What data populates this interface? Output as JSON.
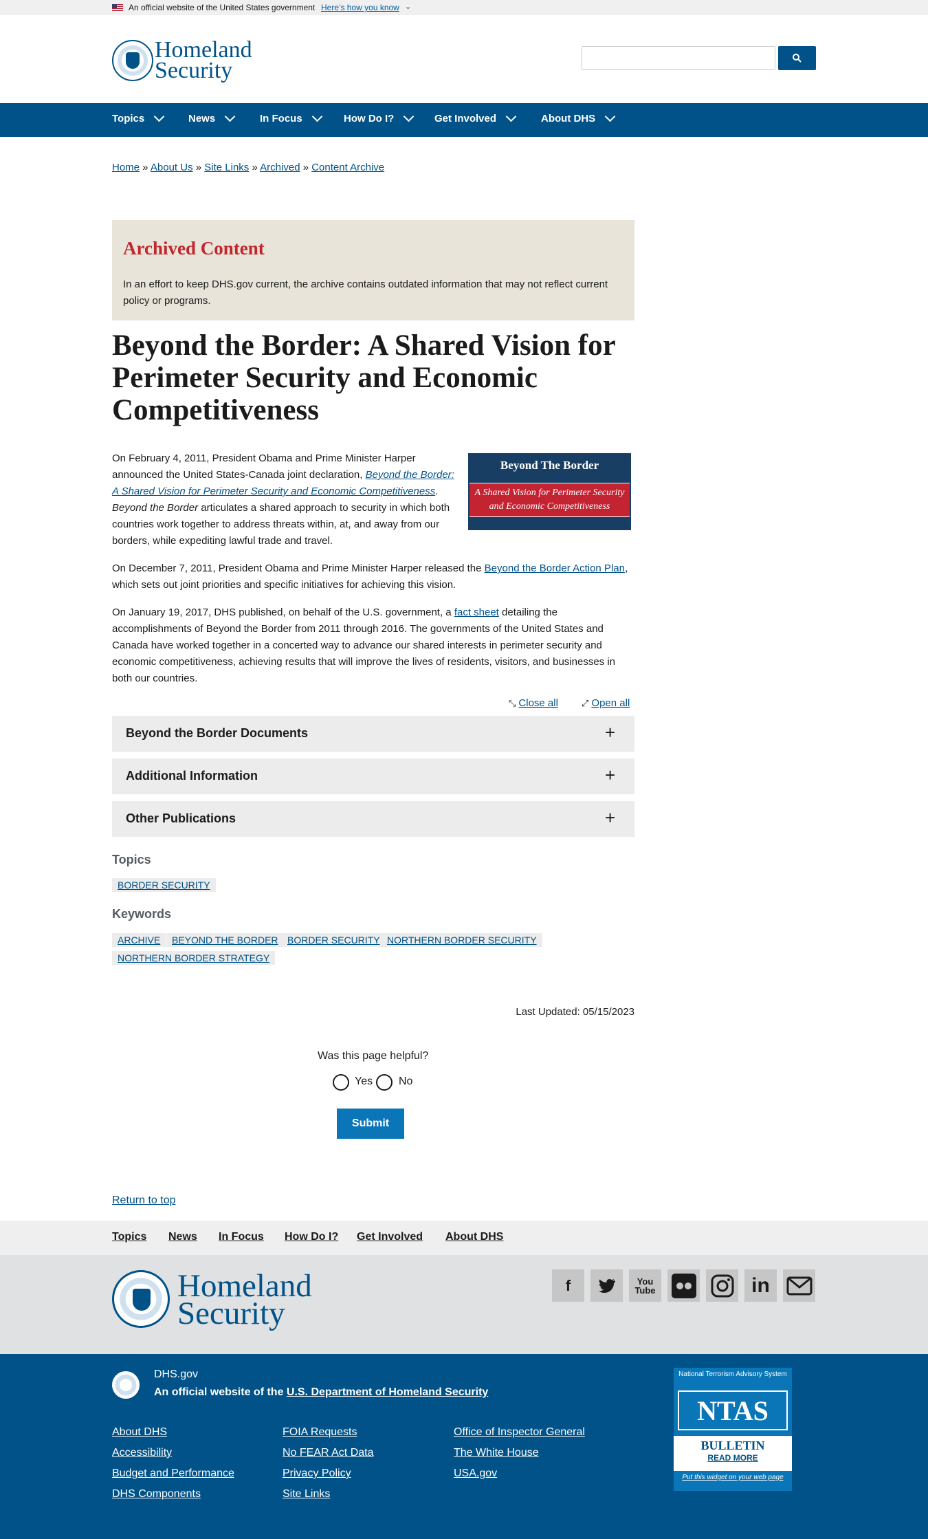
{
  "gov_banner": {
    "text": "An official website of the United States government",
    "link": "Here’s how you know"
  },
  "header": {
    "logo_line1": "Homeland",
    "logo_line2": "Security",
    "search_placeholder": ""
  },
  "nav": [
    "Topics",
    "News",
    "In Focus",
    "How Do I?",
    "Get Involved",
    "About DHS"
  ],
  "breadcrumb": [
    "Home",
    "About Us",
    "Site Links",
    "Archived",
    "Content Archive"
  ],
  "archive": {
    "title": "Archived Content",
    "text": "In an effort to keep DHS.gov current, the archive contains outdated information that may not reflect current policy or programs."
  },
  "page_title": "Beyond the Border: A Shared Vision for Perimeter Security and Economic Competitiveness",
  "body": {
    "p1_a": "On February 4, 2011, President Obama and Prime Minister Harper announced the United States-Canada joint declaration, ",
    "p1_link": "Beyond the Border: A Shared Vision for Perimeter Security and Economic Competitiveness",
    "p1_b": ". ",
    "p1_em": "Beyond the Border",
    "p1_c": " articulates a shared approach to security in which both countries work together to address threats within, at, and away from our borders, while expediting lawful trade and travel.",
    "p2_a": "On December 7, 2011, President Obama and Prime Minister Harper released the ",
    "p2_link": "Beyond the Border Action Plan",
    "p2_b": ", which sets out joint priorities and specific initiatives for achieving this vision.",
    "p3_a": "On January 19, 2017, DHS published, on behalf of the U.S. government, a ",
    "p3_link": "fact sheet",
    "p3_b": " detailing the accomplishments of Beyond the Border from 2011 through 2016.  The governments of the United States and Canada have worked together in a concerted way to advance our shared interests in perimeter security and economic competitiveness, achieving results that will improve the lives of residents, visitors, and businesses in both our countries."
  },
  "image": {
    "title": "Beyond The Border",
    "subtitle": "A Shared Vision for Perimeter Security and Economic Competitiveness"
  },
  "accordion_controls": {
    "close": "Close all",
    "open": "Open all"
  },
  "accordions": [
    "Beyond the Border Documents",
    "Additional Information",
    "Other Publications"
  ],
  "topics": {
    "heading": "Topics",
    "tags": [
      "BORDER SECURITY"
    ]
  },
  "keywords": {
    "heading": "Keywords",
    "tags": [
      "ARCHIVE",
      "BEYOND THE BORDER",
      "BORDER SECURITY",
      "NORTHERN BORDER SECURITY",
      "NORTHERN BORDER STRATEGY"
    ]
  },
  "last_updated": "Last Updated: 05/15/2023",
  "feedback": {
    "question": "Was this page helpful?",
    "yes": "Yes",
    "no": "No",
    "submit": "Submit"
  },
  "return_top": "Return to top",
  "footer_nav": [
    "Topics",
    "News",
    "In Focus",
    "How Do I?",
    "Get Involved",
    "About DHS"
  ],
  "social_icons": [
    "facebook-icon",
    "twitter-icon",
    "youtube-icon",
    "flickr-icon",
    "instagram-icon",
    "linkedin-icon",
    "email-icon"
  ],
  "footer": {
    "site": "DHS.gov",
    "official_prefix": "An official website of the ",
    "official_link": "U.S. Department of Homeland Security",
    "col1": [
      "About DHS",
      "Accessibility",
      "Budget and Performance",
      "DHS Components"
    ],
    "col2": [
      "FOIA Requests",
      "No FEAR Act Data",
      "Privacy Policy",
      "Site Links"
    ],
    "col3": [
      "Office of Inspector General",
      "The White House",
      "USA.gov"
    ]
  },
  "ntas": {
    "top": "National Terrorism Advisory System",
    "logo": "NTAS",
    "bulletin": "BULLETIN",
    "more": "READ MORE",
    "put": "Put this widget on your web page"
  },
  "colors": {
    "brand_blue": "#005288",
    "accent_red": "#c1272d",
    "archive_bg": "#e8e4d9"
  }
}
